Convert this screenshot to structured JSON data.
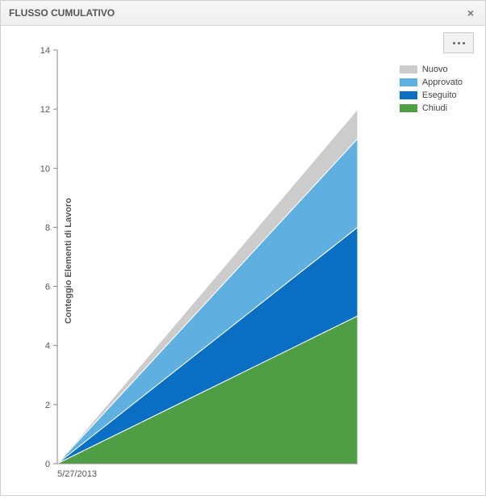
{
  "panel": {
    "title": "FLUSSO CUMULATIVO",
    "close_symbol": "×"
  },
  "toolbar": {
    "options_name": "options-button"
  },
  "chart_data": {
    "type": "area",
    "title": "",
    "xlabel": "",
    "ylabel": "Conteggio Elementi di Lavoro",
    "ylim": [
      0,
      14
    ],
    "yticks": [
      0,
      2,
      4,
      6,
      8,
      10,
      12,
      14
    ],
    "x": [
      "5/27/2013",
      ""
    ],
    "series": [
      {
        "name": "Nuovo",
        "color": "#cccccc",
        "values": [
          0,
          12
        ]
      },
      {
        "name": "Approvato",
        "color": "#5fb0e0",
        "values": [
          0,
          11
        ]
      },
      {
        "name": "Eseguito",
        "color": "#0a6fc2",
        "values": [
          0,
          8
        ]
      },
      {
        "name": "Chiudi",
        "color": "#4f9e46",
        "values": [
          0,
          5
        ]
      }
    ],
    "legend_position": "top-right",
    "grid": false
  }
}
